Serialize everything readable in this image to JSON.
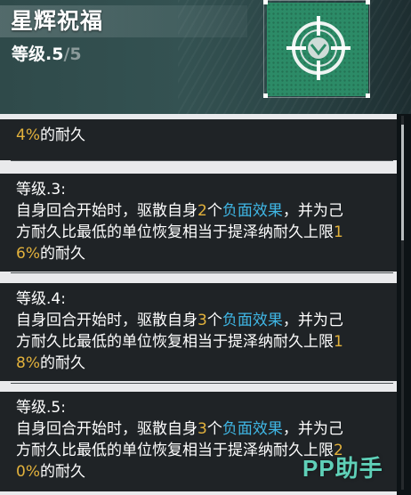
{
  "header": {
    "title": "星辉祝福",
    "level_prefix": "等级.",
    "level_current": "5",
    "level_separator": "/",
    "level_max": "5",
    "emblem_icon": "crosshair-emblem-icon",
    "emblem_color": "#2c8b67"
  },
  "entries": [
    {
      "heading": "",
      "lines": [
        [
          {
            "t": "4%",
            "c": "num"
          },
          {
            "t": "的耐久",
            "c": ""
          }
        ]
      ]
    },
    {
      "heading": "等级.3:",
      "lines": [
        [
          {
            "t": "自身回合开始时，驱散自身",
            "c": ""
          },
          {
            "t": "2",
            "c": "num"
          },
          {
            "t": "个",
            "c": ""
          },
          {
            "t": "负面效果",
            "c": "link"
          },
          {
            "t": "，并为己",
            "c": ""
          }
        ],
        [
          {
            "t": "方耐久比最低的单位恢复相当于提泽纳耐久上限",
            "c": ""
          },
          {
            "t": "1",
            "c": "num"
          }
        ],
        [
          {
            "t": "6%",
            "c": "num"
          },
          {
            "t": "的耐久",
            "c": ""
          }
        ]
      ]
    },
    {
      "heading": "等级.4:",
      "lines": [
        [
          {
            "t": "自身回合开始时，驱散自身",
            "c": ""
          },
          {
            "t": "3",
            "c": "num"
          },
          {
            "t": "个",
            "c": ""
          },
          {
            "t": "负面效果",
            "c": "link"
          },
          {
            "t": "，并为己",
            "c": ""
          }
        ],
        [
          {
            "t": "方耐久比最低的单位恢复相当于提泽纳耐久上限",
            "c": ""
          },
          {
            "t": "1",
            "c": "num"
          }
        ],
        [
          {
            "t": "8%",
            "c": "num"
          },
          {
            "t": "的耐久",
            "c": ""
          }
        ]
      ]
    },
    {
      "heading": "等级.5:",
      "lines": [
        [
          {
            "t": "自身回合开始时，驱散自身",
            "c": ""
          },
          {
            "t": "3",
            "c": "num"
          },
          {
            "t": "个",
            "c": ""
          },
          {
            "t": "负面效果",
            "c": "link"
          },
          {
            "t": "，并为己",
            "c": ""
          }
        ],
        [
          {
            "t": "方耐久比最低的单位恢复相当于提泽纳耐久上限",
            "c": ""
          },
          {
            "t": "2",
            "c": "num"
          }
        ],
        [
          {
            "t": "0%",
            "c": "num"
          },
          {
            "t": "的耐久",
            "c": ""
          }
        ]
      ]
    }
  ],
  "watermark": {
    "latin": "PP",
    "cjk": "助手"
  },
  "colors": {
    "number": "#e3b23c",
    "link": "#3fb6e4",
    "text": "#ffffff",
    "panel": "#1f2326"
  }
}
